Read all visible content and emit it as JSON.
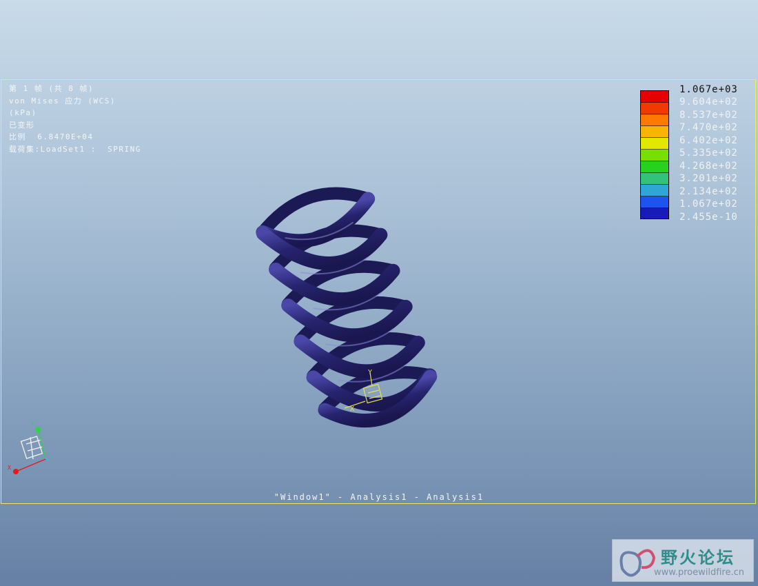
{
  "info": {
    "line1": "第 1 帧 (共 8 帧)",
    "line2": "von Mises 应力 (WCS)",
    "line3": "(kPa)",
    "line4": "已变形",
    "line5": "比例  6.8470E+04",
    "line6": "载荷集:LoadSet1 :  SPRING"
  },
  "legend": {
    "ticks": [
      "1.067e+03",
      "9.604e+02",
      "8.537e+02",
      "7.470e+02",
      "6.402e+02",
      "5.335e+02",
      "4.268e+02",
      "3.201e+02",
      "2.134e+02",
      "1.067e+02",
      "2.455e-10"
    ],
    "colors": [
      "#e60000",
      "#f03a00",
      "#ff7800",
      "#f7b400",
      "#e3e800",
      "#78e000",
      "#28d020",
      "#31c37a",
      "#2fa6d6",
      "#1d53ee",
      "#191bb8"
    ]
  },
  "window_title": "\"Window1\" - Analysis1 - Analysis1",
  "triad": {
    "x_label": "X",
    "y_label": "Y"
  },
  "csys": {
    "x_label": "X",
    "y_label": "Y"
  },
  "model": {
    "color": "#25226b"
  },
  "watermark": {
    "title": "野火论坛",
    "url": "www.proewildfire.cn"
  }
}
